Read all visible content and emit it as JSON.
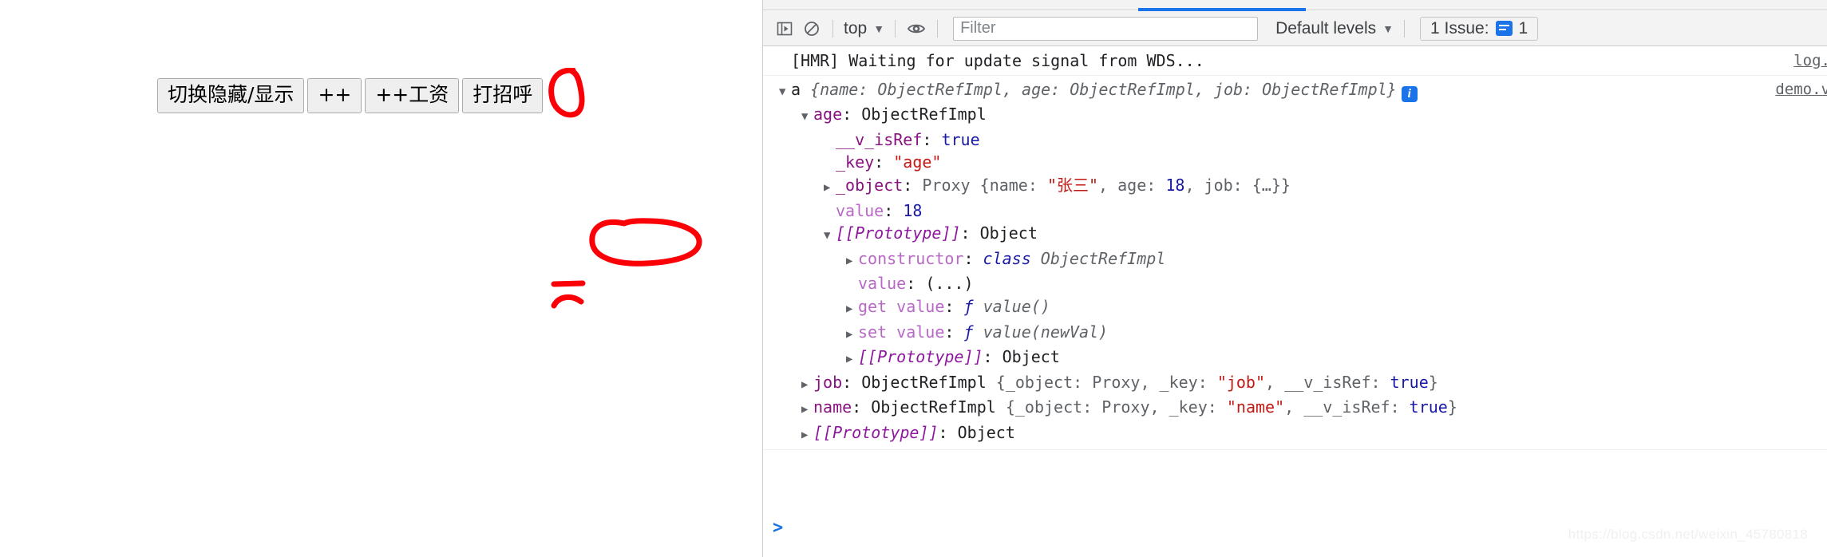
{
  "page": {
    "buttons": [
      {
        "label": "切换隐藏/显示",
        "name": "toggle-visibility-button"
      },
      {
        "label": "++",
        "name": "increment-button"
      },
      {
        "label": "++工资",
        "name": "increment-salary-button"
      },
      {
        "label": "打招呼",
        "name": "greet-button"
      }
    ]
  },
  "devtools": {
    "toolbar": {
      "sidebar_toggle_icon": "console-sidebar-icon",
      "clear_icon": "clear-console-icon",
      "context_selector": "top",
      "eye_icon": "live-expression-eye-icon",
      "filter_placeholder": "Filter",
      "filter_value": "",
      "levels_selector": "Default levels",
      "issues_label": "1 Issue:",
      "issues_count": "1",
      "caret": "▼"
    },
    "console": {
      "prompt_caret": ">",
      "prompt_value": "",
      "messages": [
        {
          "name": "console-message-hmr",
          "source": "log.",
          "rows": [
            {
              "indent": 0,
              "tri": "blank",
              "segments": [
                {
                  "text": "[HMR] Waiting for update signal from WDS...",
                  "cls": "plain"
                }
              ]
            }
          ]
        },
        {
          "name": "console-message-object",
          "source": "demo.v",
          "rows": [
            {
              "indent": 0,
              "tri": "open",
              "prefix": "a ",
              "segments": [
                {
                  "text": "{",
                  "cls": "v-obj italic"
                },
                {
                  "text": "name",
                  "cls": "v-obj italic"
                },
                {
                  "text": ": ",
                  "cls": "v-obj italic"
                },
                {
                  "text": "ObjectRefImpl",
                  "cls": "v-obj italic"
                },
                {
                  "text": ", ",
                  "cls": "v-obj italic"
                },
                {
                  "text": "age",
                  "cls": "v-obj italic"
                },
                {
                  "text": ": ",
                  "cls": "v-obj italic"
                },
                {
                  "text": "ObjectRefImpl",
                  "cls": "v-obj italic"
                },
                {
                  "text": ", ",
                  "cls": "v-obj italic"
                },
                {
                  "text": "job",
                  "cls": "v-obj italic"
                },
                {
                  "text": ": ",
                  "cls": "v-obj italic"
                },
                {
                  "text": "ObjectRefImpl}",
                  "cls": "v-obj italic"
                }
              ],
              "badge": true
            },
            {
              "indent": 1,
              "tri": "open",
              "segments": [
                {
                  "text": "age",
                  "cls": "k-prop"
                },
                {
                  "text": ": ",
                  "cls": "plain"
                },
                {
                  "text": "ObjectRefImpl",
                  "cls": "plain"
                }
              ]
            },
            {
              "indent": 2,
              "tri": "blank",
              "segments": [
                {
                  "text": "__v_isRef",
                  "cls": "k-prop"
                },
                {
                  "text": ": ",
                  "cls": "plain"
                },
                {
                  "text": "true",
                  "cls": "v-bool"
                }
              ]
            },
            {
              "indent": 2,
              "tri": "blank",
              "segments": [
                {
                  "text": "_key",
                  "cls": "k-prop"
                },
                {
                  "text": ": ",
                  "cls": "plain"
                },
                {
                  "text": "\"age\"",
                  "cls": "v-str"
                }
              ]
            },
            {
              "indent": 2,
              "tri": "closed",
              "segments": [
                {
                  "text": "_object",
                  "cls": "k-prop"
                },
                {
                  "text": ": ",
                  "cls": "plain"
                },
                {
                  "text": "Proxy ",
                  "cls": "v-obj"
                },
                {
                  "text": "{",
                  "cls": "v-obj"
                },
                {
                  "text": "name",
                  "cls": "v-obj"
                },
                {
                  "text": ": ",
                  "cls": "v-obj"
                },
                {
                  "text": "\"张三\"",
                  "cls": "v-str"
                },
                {
                  "text": ", ",
                  "cls": "v-obj"
                },
                {
                  "text": "age",
                  "cls": "v-obj"
                },
                {
                  "text": ": ",
                  "cls": "v-obj"
                },
                {
                  "text": "18",
                  "cls": "v-num"
                },
                {
                  "text": ", ",
                  "cls": "v-obj"
                },
                {
                  "text": "job",
                  "cls": "v-obj"
                },
                {
                  "text": ": ",
                  "cls": "v-obj"
                },
                {
                  "text": "{…}}",
                  "cls": "v-obj"
                }
              ]
            },
            {
              "indent": 2,
              "tri": "blank",
              "segments": [
                {
                  "text": "value",
                  "cls": "k-prop-l"
                },
                {
                  "text": ": ",
                  "cls": "plain"
                },
                {
                  "text": "18",
                  "cls": "v-num"
                }
              ]
            },
            {
              "indent": 2,
              "tri": "open",
              "segments": [
                {
                  "text": "[[Prototype]]",
                  "cls": "k-internal"
                },
                {
                  "text": ": ",
                  "cls": "plain"
                },
                {
                  "text": "Object",
                  "cls": "plain"
                }
              ]
            },
            {
              "indent": 3,
              "tri": "closed",
              "segments": [
                {
                  "text": "constructor",
                  "cls": "k-prop-l"
                },
                {
                  "text": ": ",
                  "cls": "plain"
                },
                {
                  "text": "class ",
                  "cls": "cls-kw"
                },
                {
                  "text": "ObjectRefImpl",
                  "cls": "v-func"
                }
              ]
            },
            {
              "indent": 3,
              "tri": "blank",
              "segments": [
                {
                  "text": "value",
                  "cls": "k-prop-l"
                },
                {
                  "text": ": ",
                  "cls": "plain"
                },
                {
                  "text": "(...)",
                  "cls": "plain"
                }
              ]
            },
            {
              "indent": 3,
              "tri": "closed",
              "segments": [
                {
                  "text": "get value",
                  "cls": "k-prop-l"
                },
                {
                  "text": ": ",
                  "cls": "plain"
                },
                {
                  "text": "ƒ ",
                  "cls": "fn-mark"
                },
                {
                  "text": "value()",
                  "cls": "v-func"
                }
              ]
            },
            {
              "indent": 3,
              "tri": "closed",
              "segments": [
                {
                  "text": "set value",
                  "cls": "k-prop-l"
                },
                {
                  "text": ": ",
                  "cls": "plain"
                },
                {
                  "text": "ƒ ",
                  "cls": "fn-mark"
                },
                {
                  "text": "value(newVal)",
                  "cls": "v-func"
                }
              ]
            },
            {
              "indent": 3,
              "tri": "closed",
              "segments": [
                {
                  "text": "[[Prototype]]",
                  "cls": "k-internal"
                },
                {
                  "text": ": ",
                  "cls": "plain"
                },
                {
                  "text": "Object",
                  "cls": "plain"
                }
              ]
            },
            {
              "indent": 1,
              "tri": "closed",
              "segments": [
                {
                  "text": "job",
                  "cls": "k-prop"
                },
                {
                  "text": ": ",
                  "cls": "plain"
                },
                {
                  "text": "ObjectRefImpl ",
                  "cls": "plain"
                },
                {
                  "text": "{",
                  "cls": "v-obj"
                },
                {
                  "text": "_object",
                  "cls": "v-obj"
                },
                {
                  "text": ": ",
                  "cls": "v-obj"
                },
                {
                  "text": "Proxy",
                  "cls": "v-obj"
                },
                {
                  "text": ", ",
                  "cls": "v-obj"
                },
                {
                  "text": "_key",
                  "cls": "v-obj"
                },
                {
                  "text": ": ",
                  "cls": "v-obj"
                },
                {
                  "text": "\"job\"",
                  "cls": "v-str"
                },
                {
                  "text": ", ",
                  "cls": "v-obj"
                },
                {
                  "text": "__v_isRef",
                  "cls": "v-obj"
                },
                {
                  "text": ": ",
                  "cls": "v-obj"
                },
                {
                  "text": "true",
                  "cls": "v-bool"
                },
                {
                  "text": "}",
                  "cls": "v-obj"
                }
              ]
            },
            {
              "indent": 1,
              "tri": "closed",
              "segments": [
                {
                  "text": "name",
                  "cls": "k-prop"
                },
                {
                  "text": ": ",
                  "cls": "plain"
                },
                {
                  "text": "ObjectRefImpl ",
                  "cls": "plain"
                },
                {
                  "text": "{",
                  "cls": "v-obj"
                },
                {
                  "text": "_object",
                  "cls": "v-obj"
                },
                {
                  "text": ": ",
                  "cls": "v-obj"
                },
                {
                  "text": "Proxy",
                  "cls": "v-obj"
                },
                {
                  "text": ", ",
                  "cls": "v-obj"
                },
                {
                  "text": "_key",
                  "cls": "v-obj"
                },
                {
                  "text": ": ",
                  "cls": "v-obj"
                },
                {
                  "text": "\"name\"",
                  "cls": "v-str"
                },
                {
                  "text": ", ",
                  "cls": "v-obj"
                },
                {
                  "text": "__v_isRef",
                  "cls": "v-obj"
                },
                {
                  "text": ": ",
                  "cls": "v-obj"
                },
                {
                  "text": "true",
                  "cls": "v-bool"
                },
                {
                  "text": "}",
                  "cls": "v-obj"
                }
              ]
            },
            {
              "indent": 1,
              "tri": "closed",
              "segments": [
                {
                  "text": "[[Prototype]]",
                  "cls": "k-internal"
                },
                {
                  "text": ": ",
                  "cls": "plain"
                },
                {
                  "text": "Object",
                  "cls": "plain"
                }
              ]
            }
          ]
        }
      ]
    }
  },
  "watermark": "https://blog.csdn.net/weixin_45780818",
  "colors": {
    "accent": "#1a73e8",
    "annotation": "#fb0007",
    "string": "#c41a16",
    "number": "#1a1aa6",
    "property": "#881280",
    "toolbar_bg": "#f3f3f3"
  }
}
